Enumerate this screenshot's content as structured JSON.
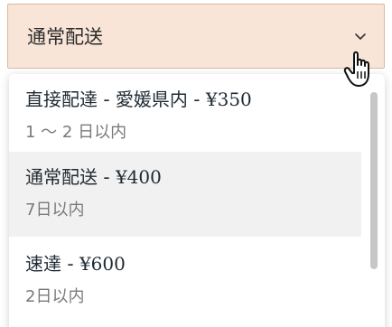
{
  "select": {
    "selected_value": "通常配送",
    "chevron_icon": "chevron-down-icon"
  },
  "options": [
    {
      "title": "直接配達 - 愛媛県内 - ",
      "price": "¥350",
      "subtitle": "1 〜 2 日以内"
    },
    {
      "title": "通常配送 - ",
      "price": "¥400",
      "subtitle": "7日以内"
    },
    {
      "title": "速達 - ",
      "price": "¥600",
      "subtitle": "2日以内"
    }
  ],
  "colors": {
    "trigger_bg": "#f8e5d7",
    "trigger_border": "#d9b9a4",
    "hover_bg": "#f1f1f1"
  },
  "cursor": {
    "icon": "hand-pointer-icon"
  }
}
